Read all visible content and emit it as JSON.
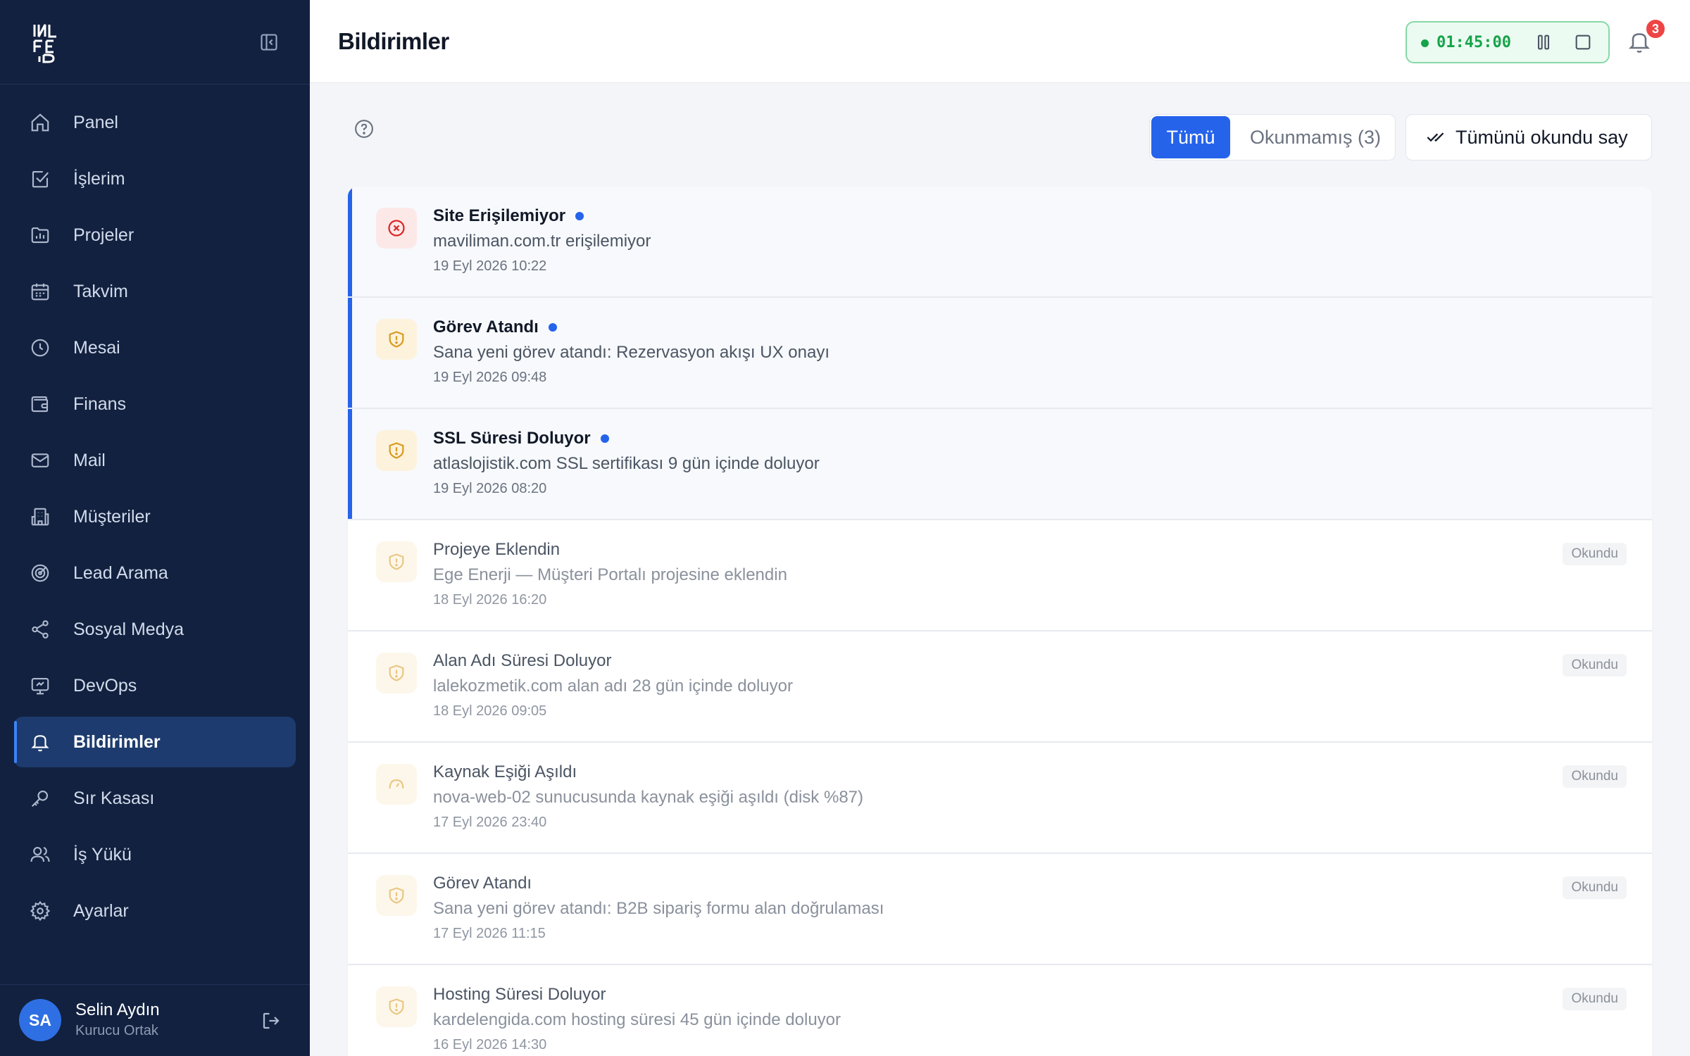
{
  "sidebar": {
    "items": [
      {
        "label": "Panel",
        "icon": "home-icon"
      },
      {
        "label": "İşlerim",
        "icon": "checkbox-icon"
      },
      {
        "label": "Projeler",
        "icon": "folder-chart-icon"
      },
      {
        "label": "Takvim",
        "icon": "calendar-icon"
      },
      {
        "label": "Mesai",
        "icon": "clock-icon"
      },
      {
        "label": "Finans",
        "icon": "wallet-icon"
      },
      {
        "label": "Mail",
        "icon": "mail-icon"
      },
      {
        "label": "Müşteriler",
        "icon": "building-icon"
      },
      {
        "label": "Lead Arama",
        "icon": "target-icon"
      },
      {
        "label": "Sosyal Medya",
        "icon": "share-icon"
      },
      {
        "label": "DevOps",
        "icon": "monitor-icon"
      },
      {
        "label": "Bildirimler",
        "icon": "bell-icon"
      },
      {
        "label": "Sır Kasası",
        "icon": "key-icon"
      },
      {
        "label": "İş Yükü",
        "icon": "users-icon"
      },
      {
        "label": "Ayarlar",
        "icon": "gear-icon"
      }
    ],
    "active_index": 11,
    "user": {
      "initials": "SA",
      "name": "Selin Aydın",
      "role": "Kurucu Ortak"
    }
  },
  "header": {
    "title": "Bildirimler",
    "timer": "01:45:00",
    "notification_count": "3"
  },
  "toolbar": {
    "filter_all": "Tümü",
    "filter_unread": "Okunmamış (3)",
    "mark_all_read": "Tümünü okundu say"
  },
  "notifications": [
    {
      "title": "Site Erişilemiyor",
      "message": "maviliman.com.tr erişilemiyor",
      "time": "19 Eyl 2026 10:22",
      "unread": true,
      "icon": "x-circle-icon"
    },
    {
      "title": "Görev Atandı",
      "message": "Sana yeni görev atandı: Rezervasyon akışı UX onayı",
      "time": "19 Eyl 2026 09:48",
      "unread": true,
      "icon": "shield-alert-icon"
    },
    {
      "title": "SSL Süresi Doluyor",
      "message": "atlaslojistik.com SSL sertifikası 9 gün içinde doluyor",
      "time": "19 Eyl 2026 08:20",
      "unread": true,
      "icon": "shield-alert-icon"
    },
    {
      "title": "Projeye Eklendin",
      "message": "Ege Enerji — Müşteri Portalı projesine eklendin",
      "time": "18 Eyl 2026 16:20",
      "unread": false,
      "badge": "Okundu",
      "icon": "shield-alert-icon"
    },
    {
      "title": "Alan Adı Süresi Doluyor",
      "message": "lalekozmetik.com alan adı 28 gün içinde doluyor",
      "time": "18 Eyl 2026 09:05",
      "unread": false,
      "badge": "Okundu",
      "icon": "shield-alert-icon"
    },
    {
      "title": "Kaynak Eşiği Aşıldı",
      "message": "nova-web-02 sunucusunda kaynak eşiği aşıldı (disk %87)",
      "time": "17 Eyl 2026 23:40",
      "unread": false,
      "badge": "Okundu",
      "icon": "gauge-icon"
    },
    {
      "title": "Görev Atandı",
      "message": "Sana yeni görev atandı: B2B sipariş formu alan doğrulaması",
      "time": "17 Eyl 2026 11:15",
      "unread": false,
      "badge": "Okundu",
      "icon": "shield-alert-icon"
    },
    {
      "title": "Hosting Süresi Doluyor",
      "message": "kardelengida.com hosting süresi 45 gün içinde doluyor",
      "time": "16 Eyl 2026 14:30",
      "unread": false,
      "badge": "Okundu",
      "icon": "shield-alert-icon"
    }
  ],
  "colors": {
    "sidebar_bg": "#12213f",
    "active_bg": "#1d3b6e",
    "accent": "#2563eb",
    "timer_green": "#16a34a",
    "badge_red": "#ef4444",
    "error_red": "#dc2626",
    "warning_amber": "#d99a1e"
  }
}
